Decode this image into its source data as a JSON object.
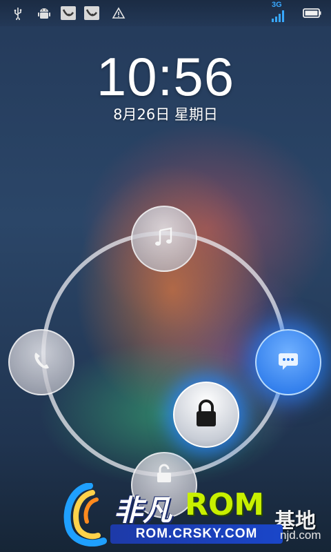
{
  "statusbar": {
    "icons": [
      "usb-icon",
      "android-debug-icon",
      "notification-app-icon",
      "notification-app-icon",
      "warning-icon"
    ],
    "network_label": "3G",
    "signal_icon": "signal-icon",
    "battery_icon": "battery-icon"
  },
  "lockscreen": {
    "time": "10:56",
    "date": "8月26日 星期日",
    "ring_buttons": {
      "top": "music-icon",
      "left": "phone-icon",
      "right": "message-icon",
      "bottom": "unlock-icon",
      "center": "lock-icon"
    },
    "accent_color": "#1f6fe6"
  },
  "watermark": {
    "brand_cn": "非凡",
    "brand_rom": "ROM",
    "base_cn": "基地",
    "url": "ROM.CRSKY.COM",
    "side_text": "njd.com"
  }
}
